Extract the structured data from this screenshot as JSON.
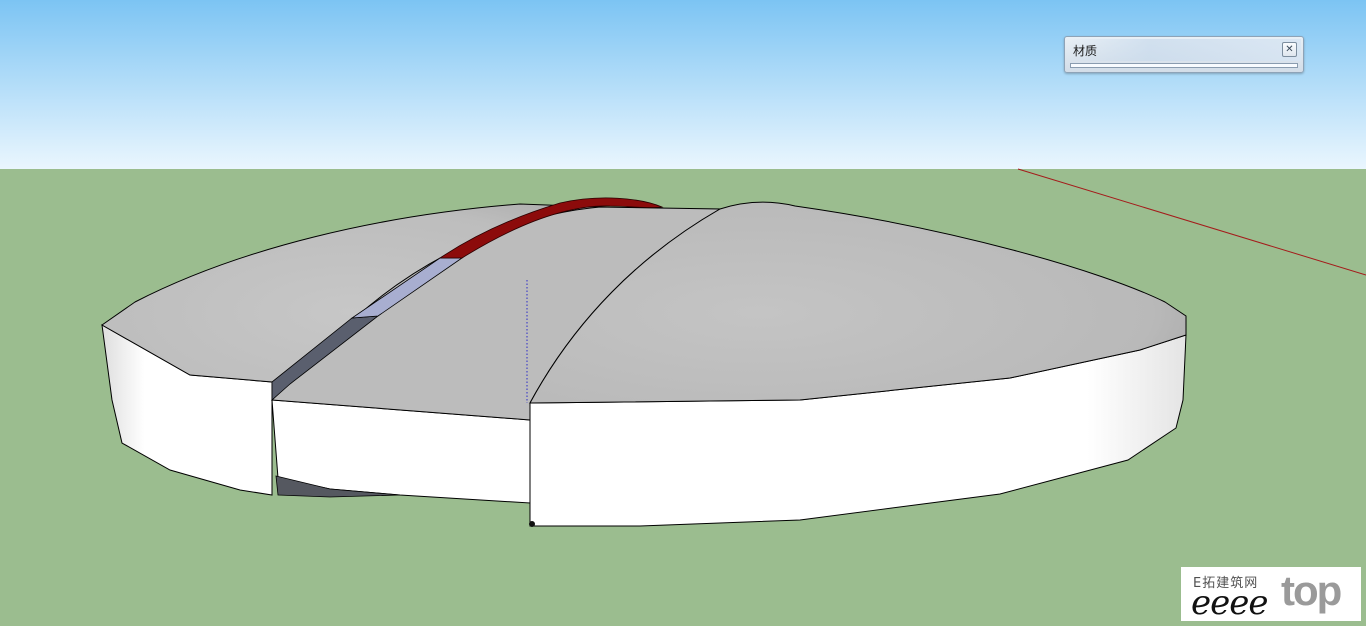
{
  "materials_tray": {
    "title": "材质",
    "close_icon": "close-icon"
  },
  "watermark": {
    "chinese_text": "E拓建筑网",
    "script_text": "eeee",
    "top_text": "top"
  },
  "colors": {
    "sky_top": "#7cc4f3",
    "sky_bottom": "#eaf6fe",
    "ground": "#9bbd8f",
    "roof": "#c2c2c2",
    "wall": "#ffffff",
    "red_band": "#8c0b0b",
    "axis_red": "#a41b1b",
    "axis_blue": "#2a2ac8"
  }
}
